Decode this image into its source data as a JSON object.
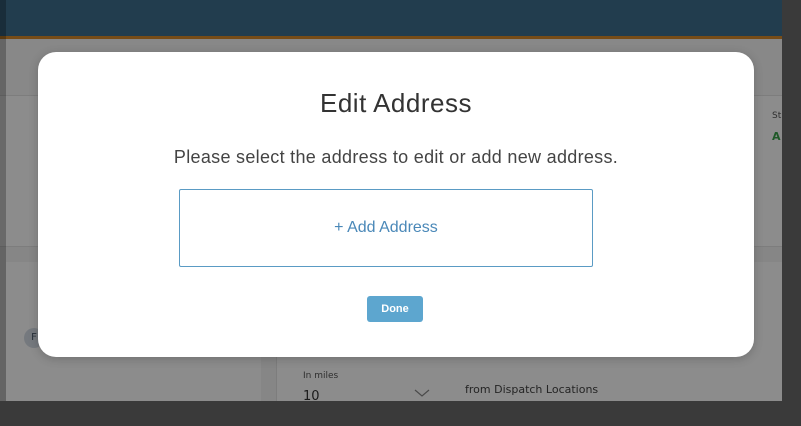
{
  "background": {
    "status_label": "St",
    "status_value": "A",
    "avatar_initial": "F",
    "distance_label": "In miles",
    "distance_value": "10",
    "dispatch_text": "from Dispatch Locations"
  },
  "modal": {
    "title": "Edit Address",
    "subtitle": "Please select the address to edit or add new address.",
    "add_address_label": "+ Add Address",
    "done_label": "Done"
  },
  "colors": {
    "topbar": "#3f6f8f",
    "topbar_accent": "#d98b2b",
    "link_blue": "#4a88b8",
    "done_button": "#5da6cf",
    "status_green": "#3aa34a"
  },
  "icons": {
    "distance_dropdown": "chevron-down-icon"
  }
}
